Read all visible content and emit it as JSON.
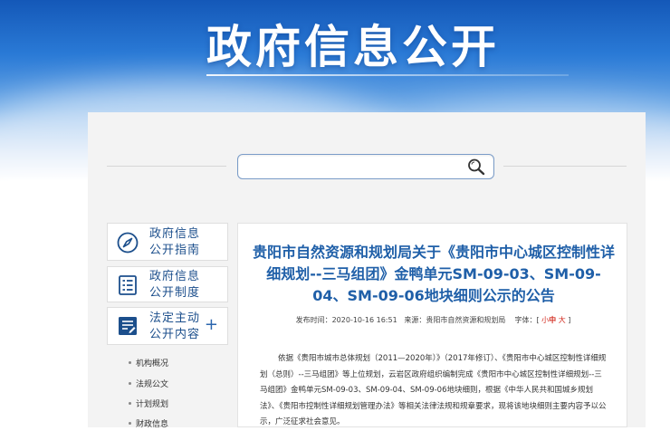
{
  "banner": {
    "title": "政府信息公开"
  },
  "search": {
    "placeholder": "",
    "icon": "search-icon"
  },
  "sidebar": {
    "items": [
      {
        "label": "政府信息\n公开指南",
        "icon": "compass-icon"
      },
      {
        "label": "政府信息\n公开制度",
        "icon": "document-list-icon"
      },
      {
        "label": "法定主动\n公开内容",
        "icon": "document-edit-icon",
        "expand": "+"
      }
    ],
    "sub_items": [
      "机构概况",
      "法规公文",
      "计划规划",
      "财政信息"
    ]
  },
  "article": {
    "title": "贵阳市自然资源和规划局关于《贵阳市中心城区控制性详细规划--三马组团》金鸭单元SM-09-03、SM-09-04、SM-09-06地块细则公示的公告",
    "meta": {
      "date_label": "发布时间：",
      "date": "2020-10-16 16:51",
      "source_label": "来源：",
      "source": "贵阳市自然资源和规划局",
      "font_label": "字体：[",
      "font_small": "小",
      "font_mid": "中",
      "font_large": "大",
      "font_close": "]"
    },
    "body": "依据《贵阳市城市总体规划（2011—2020年）》（2017年修订）、《贵阳市中心城区控制性详细规划（总则）--三马组团》等上位规划，云岩区政府组织编制完成《贵阳市中心城区控制性详细规划--三马组团》金鸭单元SM-09-03、SM-09-04、SM-09-06地块细则，根据《中华人民共和国城乡规划法》、《贵阳市控制性详细规划管理办法》等相关法律法规和规章要求，现将该地块细则主要内容予以公示，广泛征求社会意见。"
  },
  "colors": {
    "brand_blue": "#1f5fa8",
    "accent_red": "#d22a1e",
    "panel_gray": "#f3f3f3"
  }
}
